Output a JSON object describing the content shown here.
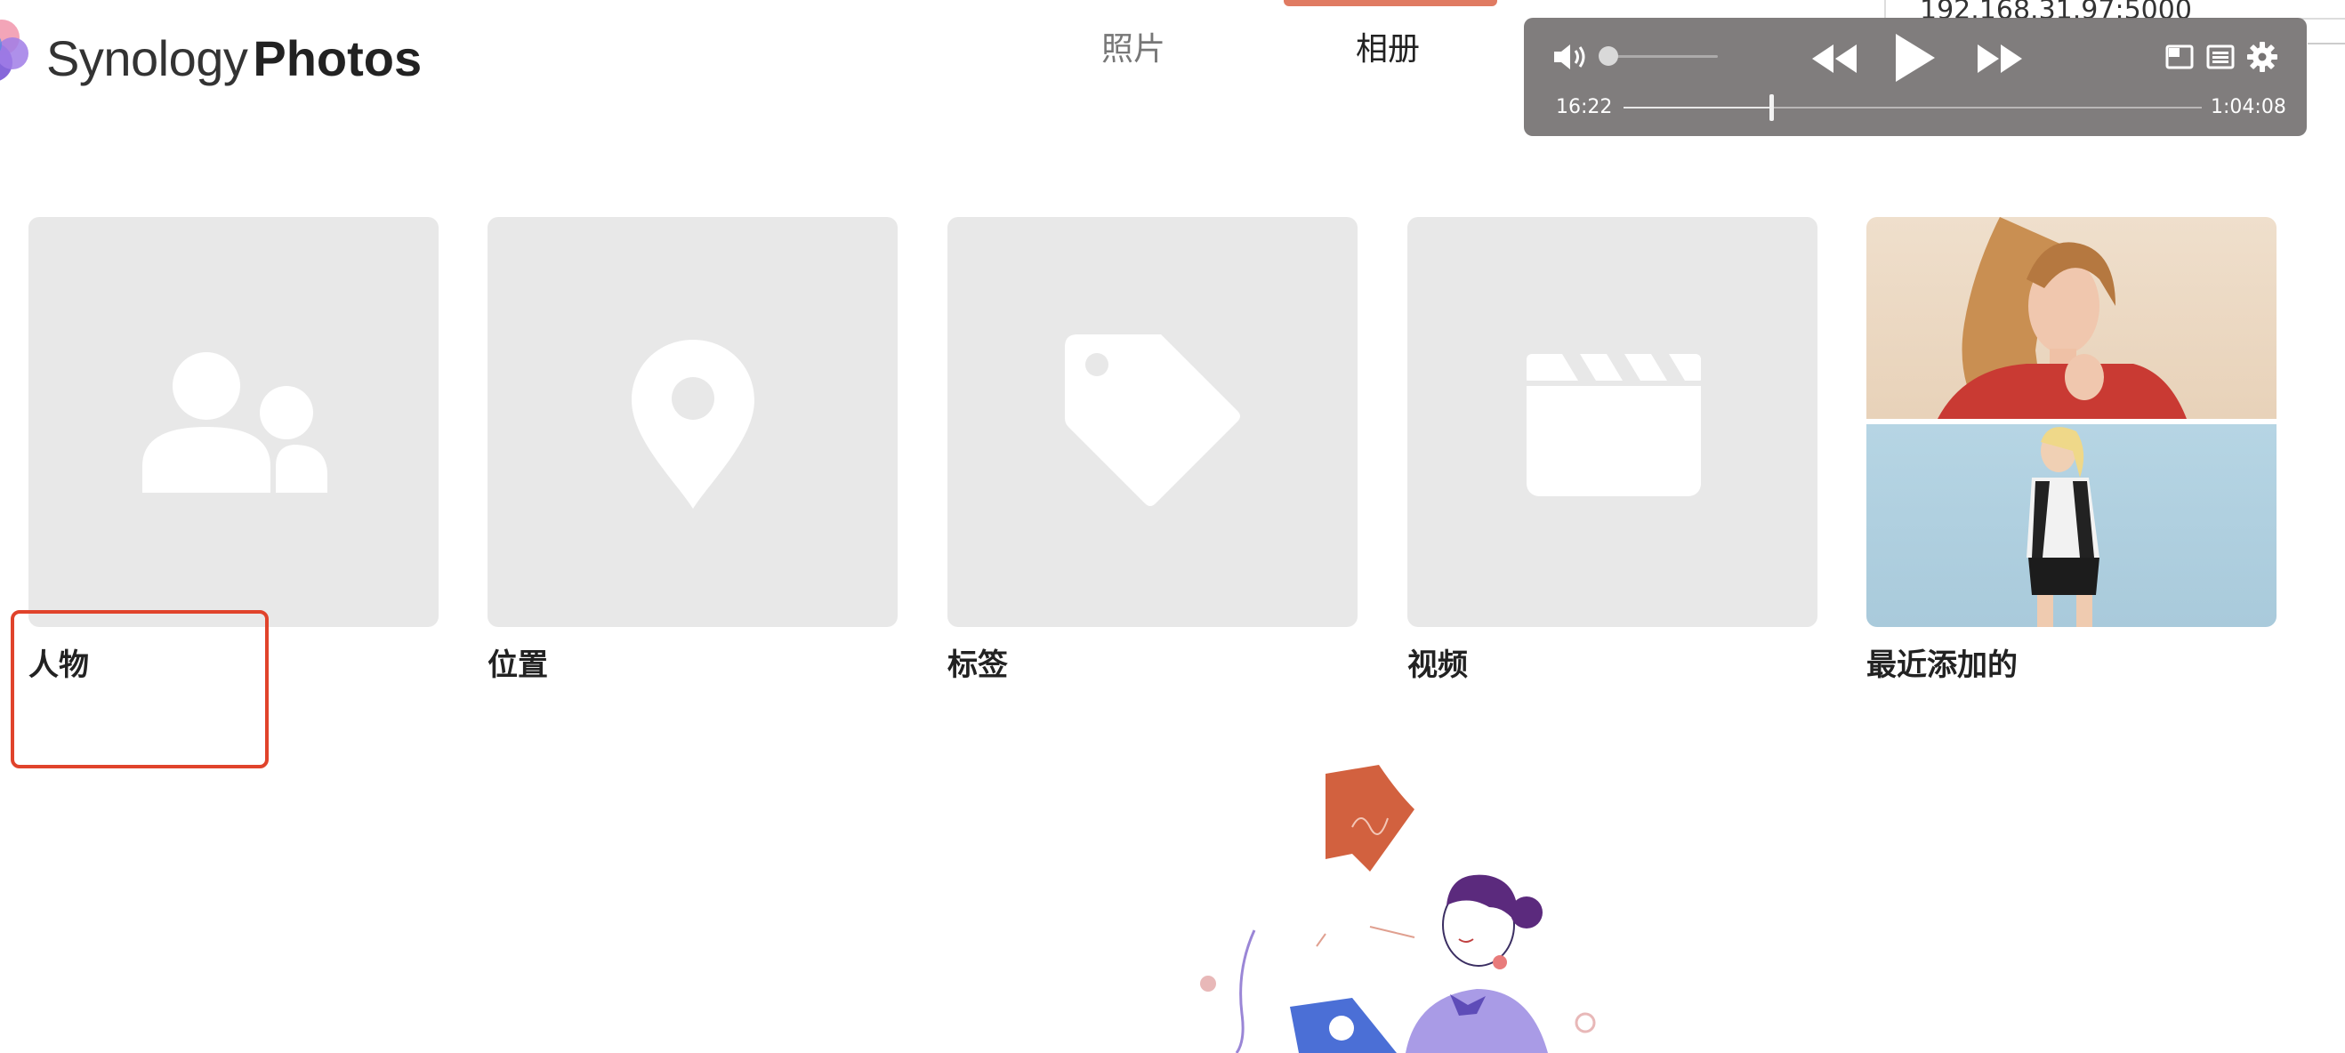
{
  "header": {
    "logo_light": "Synology",
    "logo_bold": "Photos",
    "tabs": [
      {
        "label": "照片",
        "active": false
      },
      {
        "label": "相册",
        "active": true
      }
    ],
    "accent_color": "#e07b62"
  },
  "browser": {
    "url": "192.168.31.97:5000"
  },
  "player": {
    "current_time": "16:22",
    "total_time": "1:04:08",
    "progress_fraction": 0.255,
    "volume_fraction": 0.05,
    "icons": [
      "volume-icon",
      "rewind-icon",
      "play-icon",
      "fast-forward-icon",
      "picture-in-picture-icon",
      "list-icon",
      "gear-icon"
    ]
  },
  "albums": [
    {
      "label": "人物",
      "icon": "people-icon"
    },
    {
      "label": "位置",
      "icon": "location-pin-icon"
    },
    {
      "label": "标签",
      "icon": "tag-icon"
    },
    {
      "label": "视频",
      "icon": "clapperboard-icon"
    },
    {
      "label": "最近添加的",
      "icon": "recent-photos-thumbnail"
    }
  ],
  "highlight_color": "#e0432b"
}
